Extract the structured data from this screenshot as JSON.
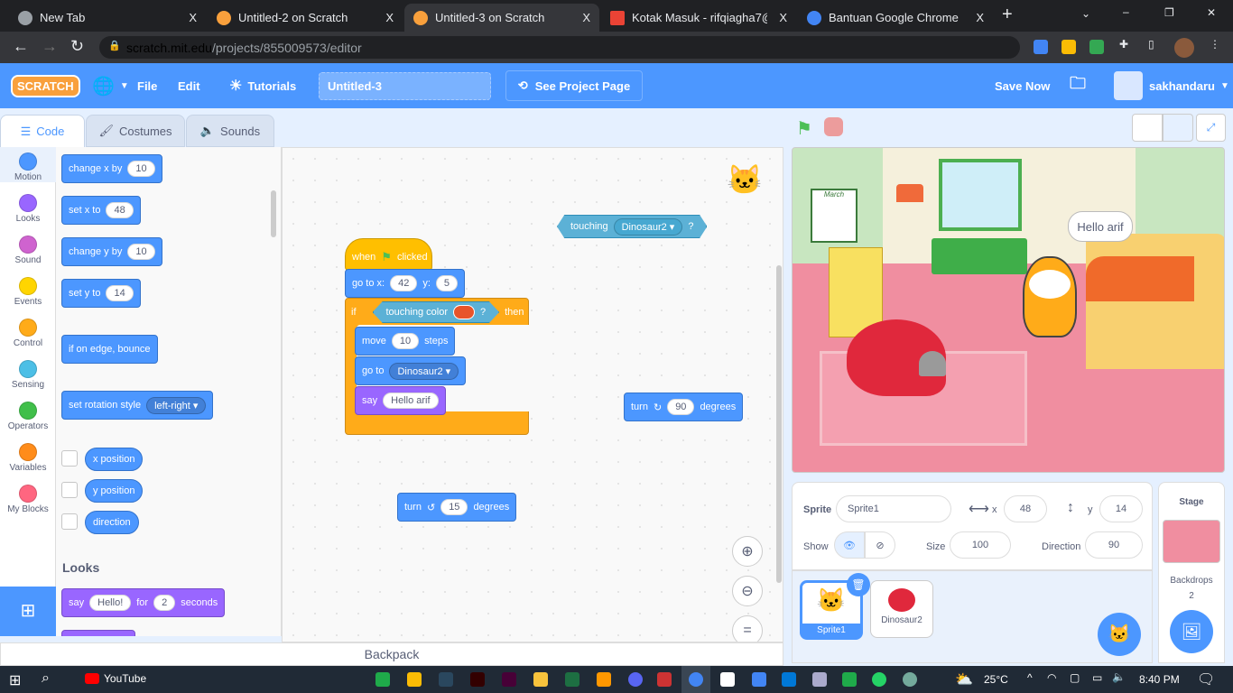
{
  "browser": {
    "tabs": [
      {
        "label": "New Tab"
      },
      {
        "label": "Untitled-2 on Scratch"
      },
      {
        "label": "Untitled-3 on Scratch",
        "active": true
      },
      {
        "label": "Kotak Masuk - rifqiagha7@g"
      },
      {
        "label": "Bantuan Google Chrome"
      }
    ],
    "url_host": "scratch.mit.edu",
    "url_path": "/projects/855009573/editor",
    "close": "X",
    "new_tab": "+"
  },
  "menu": {
    "logo": "SCRATCH",
    "file": "File",
    "edit": "Edit",
    "tutorials": "Tutorials",
    "title": "Untitled-3",
    "see_project": "See Project Page",
    "save_now": "Save Now",
    "user": "sakhandaru"
  },
  "editor_tabs": {
    "code": "Code",
    "costumes": "Costumes",
    "sounds": "Sounds"
  },
  "categories": [
    {
      "label": "Motion",
      "color": "#4c97ff"
    },
    {
      "label": "Looks",
      "color": "#9966ff"
    },
    {
      "label": "Sound",
      "color": "#cf63cf"
    },
    {
      "label": "Events",
      "color": "#ffd500"
    },
    {
      "label": "Control",
      "color": "#ffab19"
    },
    {
      "label": "Sensing",
      "color": "#4cbfe6"
    },
    {
      "label": "Operators",
      "color": "#40bf4a"
    },
    {
      "label": "Variables",
      "color": "#ff8c1a"
    },
    {
      "label": "My Blocks",
      "color": "#ff6680"
    }
  ],
  "palette": {
    "change_x": "change x by",
    "change_x_val": "10",
    "set_x": "set x to",
    "set_x_val": "48",
    "change_y": "change y by",
    "change_y_val": "10",
    "set_y": "set y to",
    "set_y_val": "14",
    "bounce": "if on edge, bounce",
    "rotation": "set rotation style",
    "rotation_val": "left-right",
    "x_pos": "x position",
    "y_pos": "y position",
    "direction": "direction",
    "looks_heading": "Looks",
    "say": "say",
    "say_val": "Hello!",
    "for": "for",
    "secs_val": "2",
    "seconds": "seconds"
  },
  "script": {
    "when": "when",
    "clicked": "clicked",
    "goto_xy": "go to x:",
    "x_val": "42",
    "y_label": "y:",
    "y_val": "5",
    "if": "if",
    "touching_color": "touching color",
    "q": "?",
    "then": "then",
    "move": "move",
    "move_val": "10",
    "steps": "steps",
    "goto": "go to",
    "goto_val": "Dinosaur2",
    "say": "say",
    "say_val": "Hello arif",
    "touching": "touching",
    "touching_val": "Dinosaur2",
    "turn": "turn",
    "turn_right_val": "90",
    "degrees": "degrees",
    "turn_left_val": "15",
    "touch_color_swatch": "#e8542a"
  },
  "backpack": "Backpack",
  "stage": {
    "bubble": "Hello arif",
    "poster": "March"
  },
  "sprite_info": {
    "sprite_label": "Sprite",
    "sprite_name": "Sprite1",
    "x_label": "x",
    "x": "48",
    "y_label": "y",
    "y": "14",
    "show_label": "Show",
    "size_label": "Size",
    "size": "100",
    "direction_label": "Direction",
    "direction": "90"
  },
  "sprites": [
    {
      "name": "Sprite1",
      "selected": true
    },
    {
      "name": "Dinosaur2"
    }
  ],
  "stage_panel": {
    "title": "Stage",
    "backdrops_label": "Backdrops",
    "backdrops_count": "2"
  },
  "taskbar": {
    "youtube": "YouTube",
    "temp": "25°C",
    "time": "8:40 PM"
  }
}
